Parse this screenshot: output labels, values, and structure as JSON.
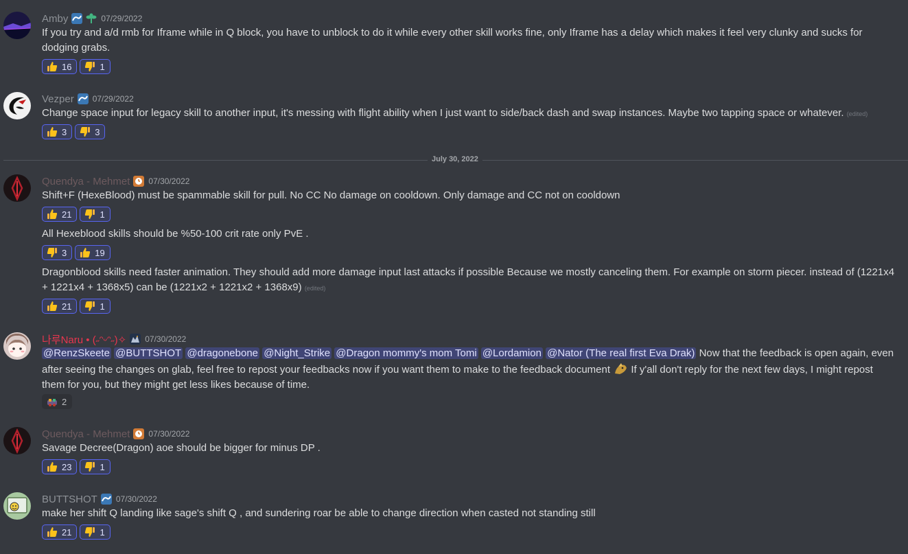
{
  "date_divider": "July 30, 2022",
  "messages": [
    {
      "author": "Amby",
      "author_color": "#8e9297",
      "timestamp": "07/29/2022",
      "text": "If you try and a/d rmb for Iframe while in Q block, you have to unblock to do it while every other skill works fine, only Iframe has a delay which makes it feel very clunky and sucks for dodging grabs.",
      "reactions": [
        {
          "emoji": "thumbs-up",
          "count": "16"
        },
        {
          "emoji": "thumbs-down",
          "count": "1"
        }
      ]
    },
    {
      "author": "Vezper",
      "author_color": "#8e9297",
      "timestamp": "07/29/2022",
      "text": "Change space input for legacy skill to another input, it's messing with flight ability when I just want to side/back dash and swap instances. Maybe two tapping space or whatever.",
      "edited": "(edited)",
      "reactions": [
        {
          "emoji": "thumbs-up",
          "count": "3"
        },
        {
          "emoji": "thumbs-down",
          "count": "3"
        }
      ]
    },
    {
      "author": "Quendya - Mehmet",
      "author_color": "#6d5a5e",
      "timestamp": "07/30/2022",
      "text": "Shift+F (HexeBlood) must be spammable skill for pull. No CC No damage on cooldown. Only damage and CC not on cooldown",
      "reactions": [
        {
          "emoji": "thumbs-up",
          "count": "21"
        },
        {
          "emoji": "thumbs-down",
          "count": "1"
        }
      ],
      "followups": [
        {
          "text": "All Hexeblood skills should be %50-100 crit rate only PvE .",
          "reactions": [
            {
              "emoji": "thumbs-down",
              "count": "3"
            },
            {
              "emoji": "thumbs-up",
              "count": "19"
            }
          ]
        },
        {
          "text": "Dragonblood skills need faster animation. They should add more damage input last attacks if possible Because we mostly canceling them. For example on storm piecer. instead of (1221x4 + 1221x4 + 1368x5) can be (1221x2 + 1221x2 + 1368x9)",
          "edited": "(edited)",
          "reactions": [
            {
              "emoji": "thumbs-up",
              "count": "21"
            },
            {
              "emoji": "thumbs-down",
              "count": "1"
            }
          ]
        }
      ]
    },
    {
      "author": "나루Naru • (˶ᵔᵕᵔ˶)✧",
      "author_color": "#e8364e",
      "timestamp": "07/30/2022",
      "mentions": [
        "@RenzSkeete",
        "@BUTTSHOT",
        "@dragonebone",
        "@Night_Strike",
        "@Dragon mommy's mom Tomi",
        "@Lordamion",
        "@Nator (The real first Eva Drak)"
      ],
      "text_part1": "Now that the feedback is open again, even after seeing the changes on glab, feel free to repost your feedbacks now if you want them to make to the feedback document",
      "text_part2": "If y'all don't reply for the next few days, I might repost them for you, but they might get less likes because of time.",
      "reactions": [
        {
          "emoji": "custom-emoji",
          "count": "2"
        }
      ]
    },
    {
      "author": "Quendya - Mehmet",
      "author_color": "#6d5a5e",
      "timestamp": "07/30/2022",
      "text": "Savage Decree(Dragon) aoe should be bigger for minus DP .",
      "reactions": [
        {
          "emoji": "thumbs-up",
          "count": "23"
        },
        {
          "emoji": "thumbs-down",
          "count": "1"
        }
      ]
    },
    {
      "author": "BUTTSHOT",
      "author_color": "#8e9297",
      "timestamp": "07/30/2022",
      "text": "make her shift Q landing like sage's shift Q , and sundering roar be able to change direction when casted not standing still",
      "reactions": [
        {
          "emoji": "thumbs-up",
          "count": "21"
        },
        {
          "emoji": "thumbs-down",
          "count": "1"
        }
      ]
    }
  ]
}
